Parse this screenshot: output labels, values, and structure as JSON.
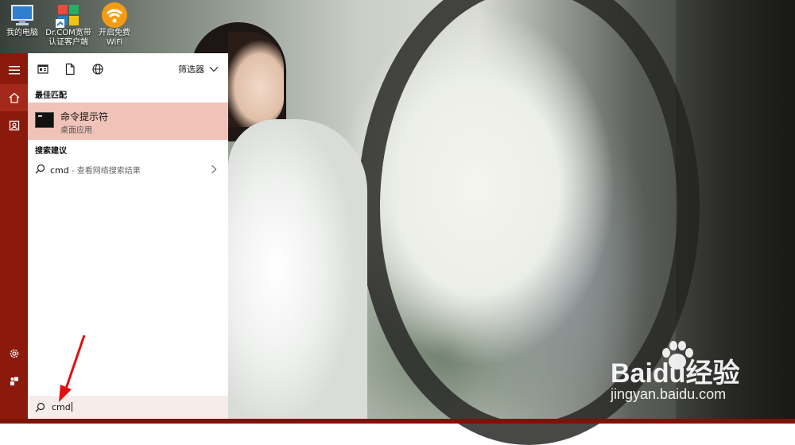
{
  "desktop": {
    "icons": [
      {
        "label": "我的电脑",
        "icon": "computer-icon"
      },
      {
        "label": "Dr.COM宽带\n认证客户端",
        "icon": "drcom-icon"
      },
      {
        "label": "开启免费\nWiFi",
        "icon": "wifi-icon"
      }
    ]
  },
  "start_menu": {
    "rail": {
      "items": [
        "hamburger-icon",
        "home-icon",
        "user-tile-icon",
        "settings-icon",
        "power-icon"
      ]
    },
    "toolbar": {
      "icons": [
        "apps-icon",
        "document-icon",
        "web-icon"
      ],
      "filter_label": "筛选器"
    },
    "best_match": {
      "section_title": "最佳匹配",
      "name": "命令提示符",
      "subtitle": "桌面应用"
    },
    "suggestions": {
      "section_title": "搜索建议",
      "query": "cmd",
      "hint": " - 查看网络搜索结果"
    },
    "search": {
      "value": "cmd"
    }
  },
  "watermark": {
    "brand": "Baidu经验",
    "url": "jingyan.baidu.com"
  },
  "colors": {
    "rail": "#8b1a0d",
    "best_match_highlight": "#f0c2b8",
    "taskbar": "#7b1408"
  }
}
